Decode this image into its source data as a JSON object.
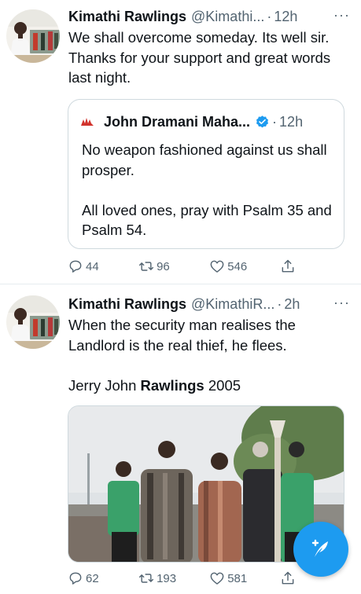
{
  "tweets": [
    {
      "display_name": "Kimathi Rawlings",
      "handle": "@Kimathi...",
      "dot": "·",
      "time": "12h",
      "more": "···",
      "text": "We shall overcome someday. Its well sir. Thanks for your support and great words last night.",
      "quote": {
        "display_name": "John Dramani Maha...",
        "dot": "·",
        "time": "12h",
        "text": "No weapon fashioned against us shall prosper.\n\nAll loved ones, pray with Psalm 35 and Psalm 54."
      },
      "stats": {
        "replies": "44",
        "retweets": "96",
        "likes": "546"
      }
    },
    {
      "display_name": "Kimathi Rawlings",
      "handle": "@KimathiR...",
      "dot": "·",
      "time": "2h",
      "more": "···",
      "text": "When the security man realises the Landlord is the real thief, he flees.",
      "signature": {
        "prefix": "Jerry John ",
        "bold": "Rawlings",
        "suffix": " 2005"
      },
      "stats": {
        "replies": "62",
        "retweets": "193",
        "likes": "581"
      }
    }
  ],
  "colors": {
    "accent": "#1d9bf0",
    "secondary_text": "#536471",
    "border": "#cfd9de"
  },
  "icons": [
    "reply-icon",
    "retweet-icon",
    "like-icon",
    "share-icon",
    "verified-icon",
    "compose-icon"
  ]
}
